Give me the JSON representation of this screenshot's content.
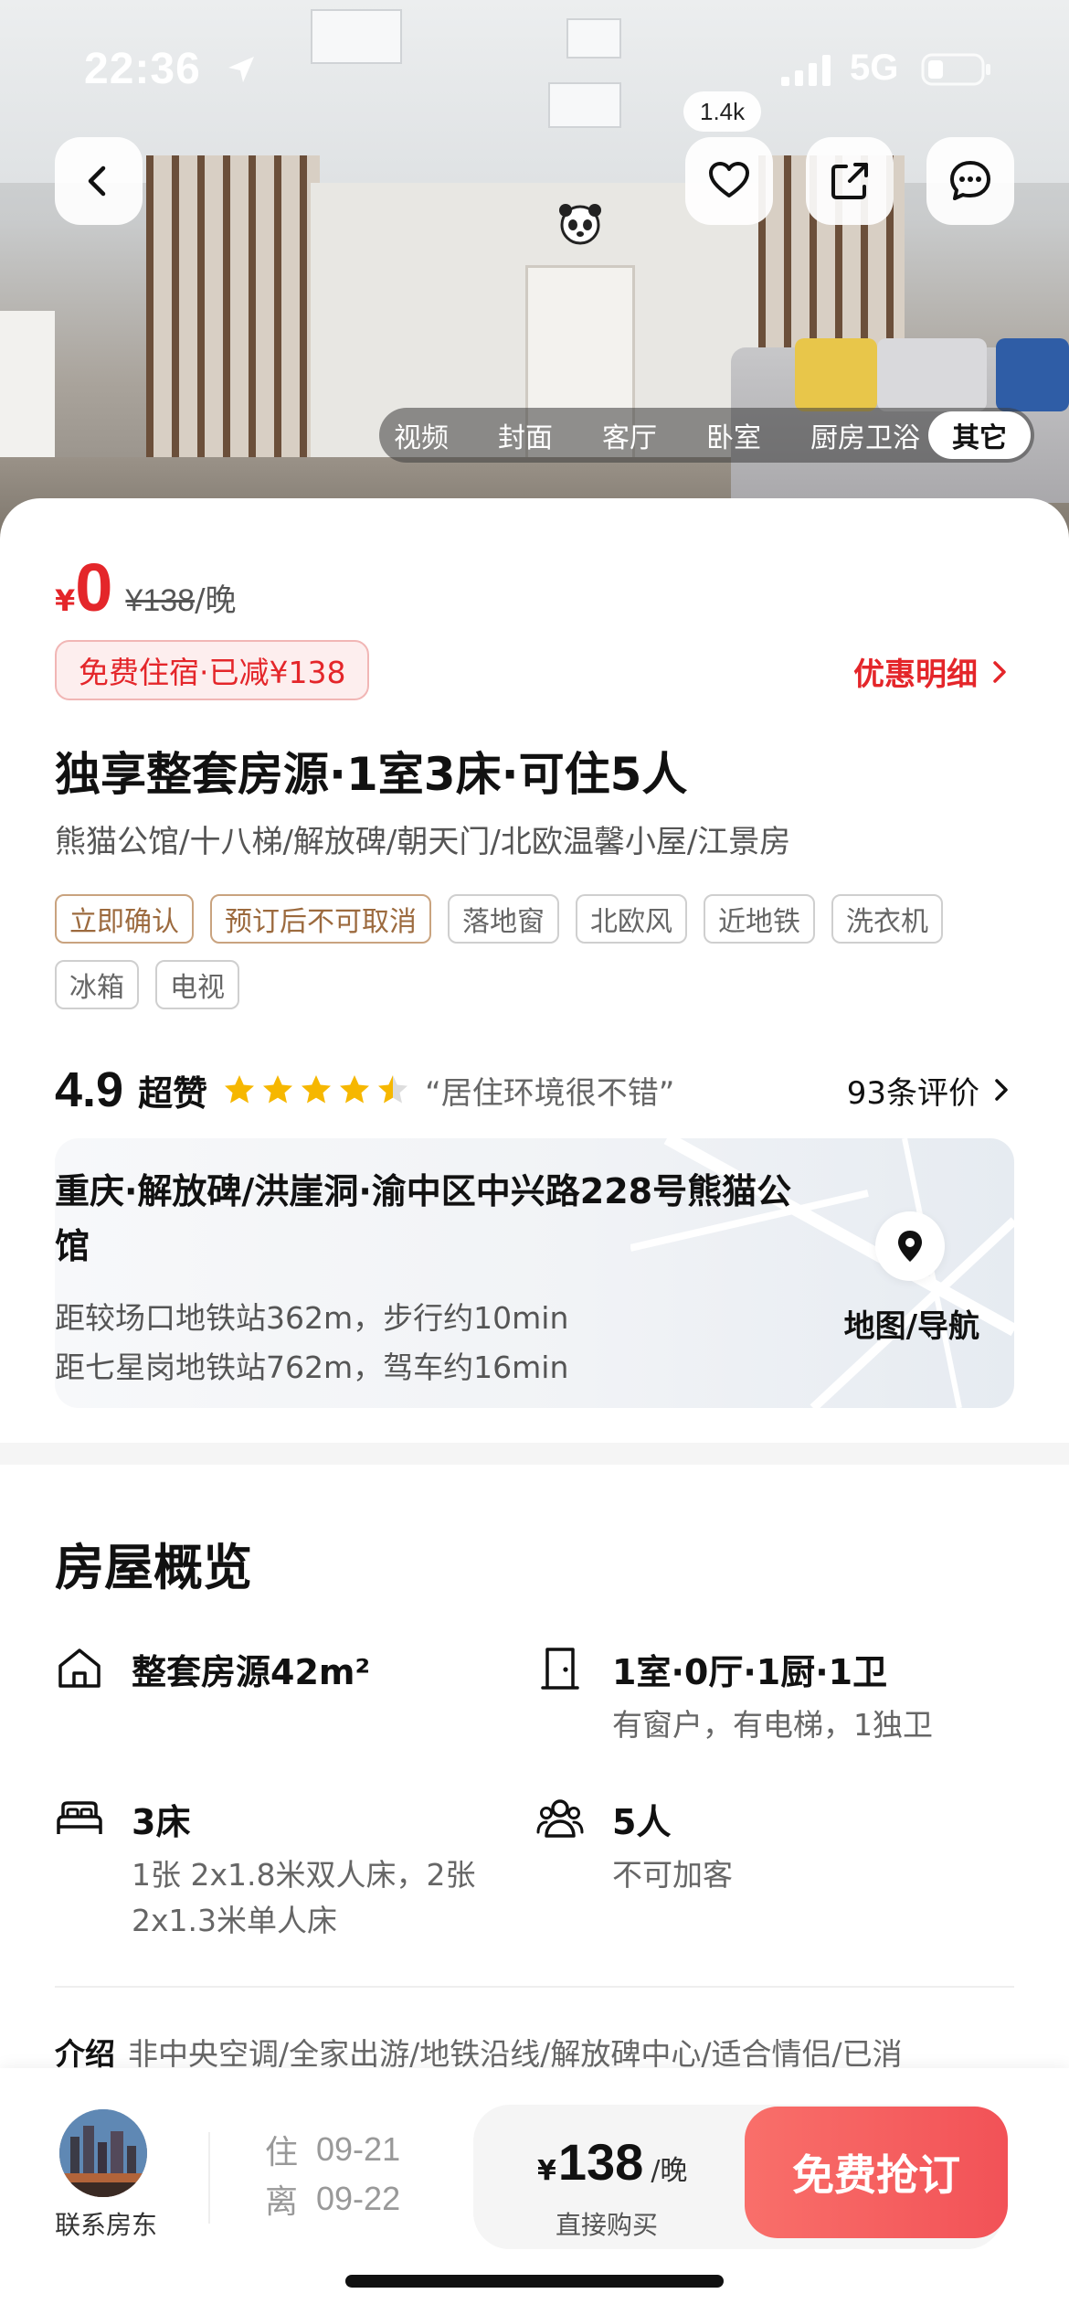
{
  "status_bar": {
    "time": "22:36",
    "network": "5G"
  },
  "hero": {
    "like_count": "1.4k",
    "photo_tabs": [
      "视频",
      "封面",
      "客厅",
      "卧室",
      "厨房卫浴"
    ],
    "active_tab": "其它"
  },
  "price": {
    "yen": "¥",
    "current": "0",
    "original": "¥138",
    "unit": "/晚",
    "discount_pill": "免费住宿·已减¥138",
    "offer_link": "优惠明细"
  },
  "listing": {
    "title": "独享整套房源·1室3床·可住5人",
    "subtitle": "熊猫公馆/十八梯/解放碑/朝天门/北欧温馨小屋/江景房",
    "tags_warm": [
      "立即确认",
      "预订后不可取消"
    ],
    "tags": [
      "落地窗",
      "北欧风",
      "近地铁",
      "洗衣机",
      "冰箱",
      "电视"
    ]
  },
  "rating": {
    "score": "4.9",
    "level": "超赞",
    "stars": 4.5,
    "quote": "“居住环境很不错”",
    "review_count": "93条评价"
  },
  "address": {
    "title": "重庆·解放碑/洪崖洞·渝中区中兴路228号熊猫公馆",
    "line1": "距较场口地铁站362m，步行约10min",
    "line2": "距七星岗地铁站762m，驾车约16min",
    "map_label": "地图/导航"
  },
  "overview": {
    "title": "房屋概览",
    "items": [
      {
        "main": "整套房源42m²",
        "sub": "",
        "icon": "house-icon"
      },
      {
        "main": "1室·0厅·1厨·1卫",
        "sub": "有窗户，有电梯，1独卫",
        "icon": "door-icon"
      },
      {
        "main": "3床",
        "sub": "1张 2x1.8米双人床，2张 2x1.3米单人床",
        "icon": "bed-icon"
      },
      {
        "main": "5人",
        "sub": "不可加客",
        "icon": "people-icon"
      }
    ],
    "intro_label": "介绍",
    "intro_text": "非中央空调/全家出游/地铁沿线/解放碑中心/适合情侣/已消"
  },
  "bottom_bar": {
    "host_label": "联系房东",
    "checkin_key": "住",
    "checkin_date": "09-21",
    "checkout_key": "离",
    "checkout_date": "09-22",
    "price_yen": "¥",
    "price": "138",
    "price_unit": "/晚",
    "buy_label": "直接购买",
    "cta": "免费抢订"
  },
  "colors": {
    "accent": "#e4262a",
    "cta": "#f25257",
    "star": "#f6b700",
    "warm_tag": "#9c6a3e"
  }
}
